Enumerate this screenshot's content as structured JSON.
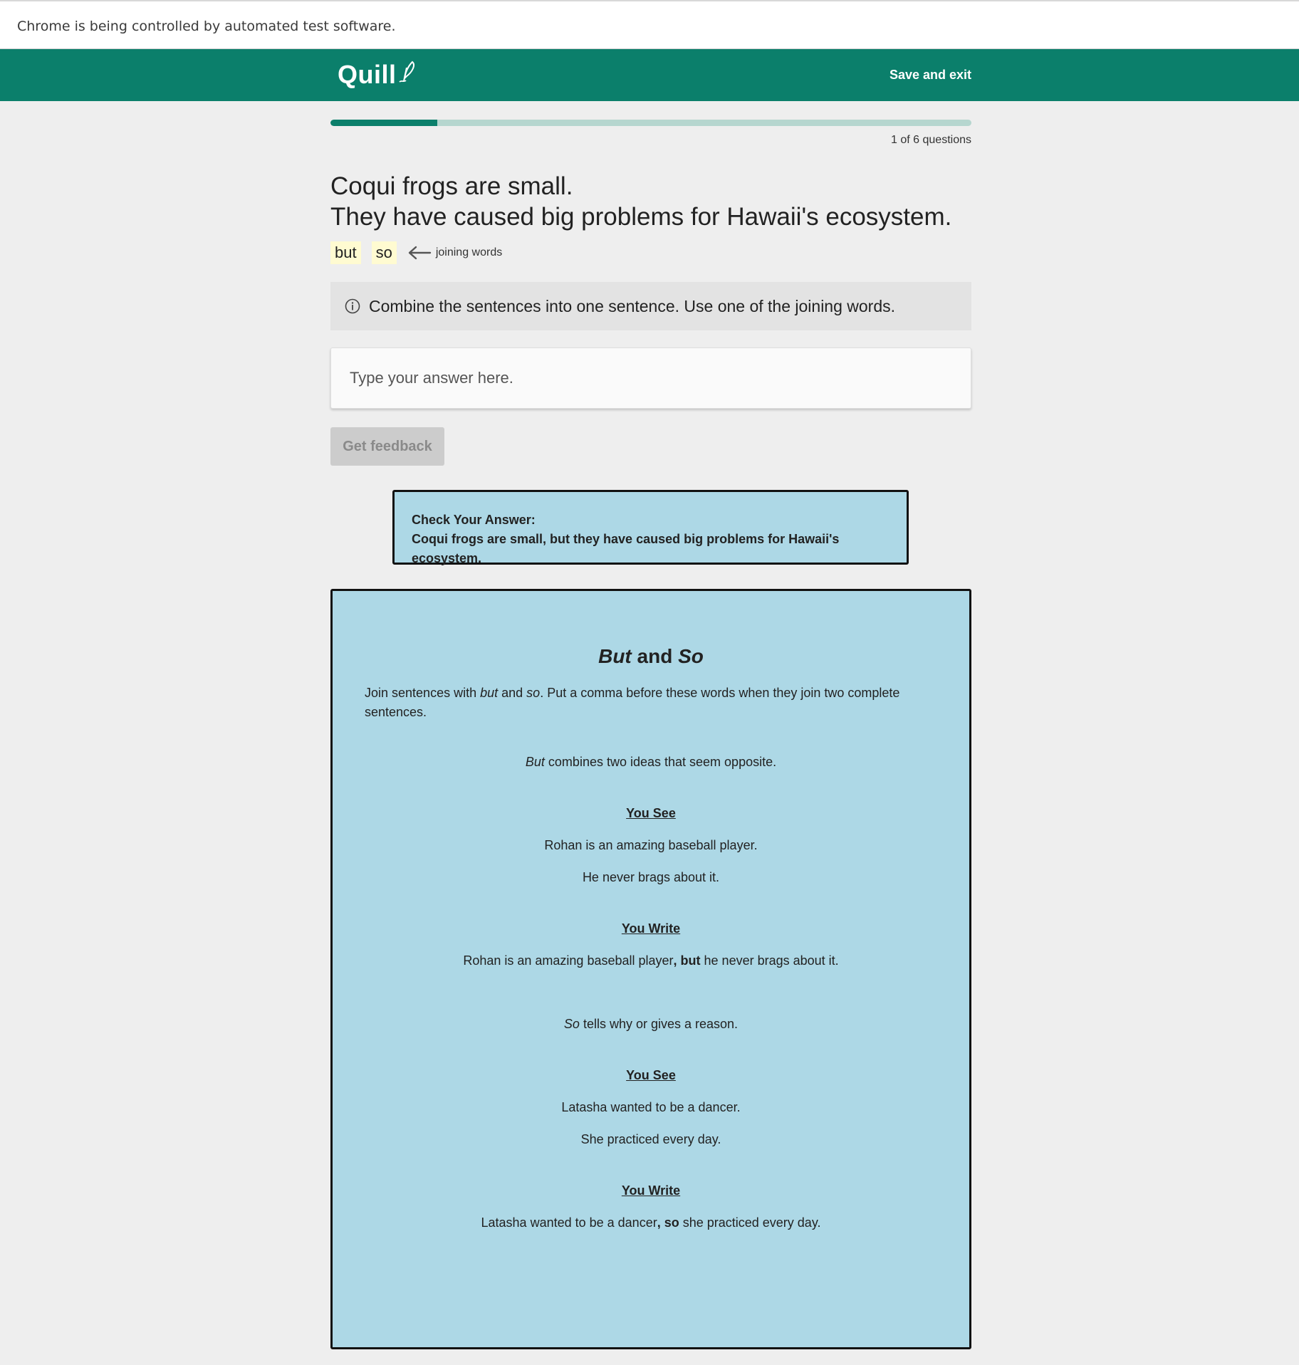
{
  "browser": {
    "automation_notice": "Chrome is being controlled by automated test software."
  },
  "header": {
    "logo_text": "Quill",
    "save_exit_label": "Save and exit",
    "brand_color": "#0b7f6b"
  },
  "progress": {
    "current": 1,
    "total": 6,
    "fraction": 0.1667,
    "label": "1 of 6 questions"
  },
  "prompt": {
    "sentence_1": "Coqui frogs are small.",
    "sentence_2": "They have caused big problems for Hawaii's ecosystem."
  },
  "joining_words": {
    "words": [
      "but",
      "so"
    ],
    "label": "joining words"
  },
  "instructions": {
    "icon": "info-icon",
    "text": "Combine the sentences into one sentence. Use one of the joining words."
  },
  "answer": {
    "placeholder": "Type your answer here.",
    "value": ""
  },
  "feedback_button": {
    "label": "Get feedback",
    "disabled": true
  },
  "check_answer": {
    "heading": "Check Your Answer:",
    "text": "Coqui frogs are small, but they have caused big problems for Hawaii's ecosystem."
  },
  "concept": {
    "title_part1": "But",
    "title_and": " and ",
    "title_part2": "So",
    "intro_1": "Join sentences with ",
    "intro_but": "but",
    "intro_2": " and ",
    "intro_so": "so",
    "intro_3": ". Put a comma before these words when they join two complete sentences.",
    "but_section": {
      "desc_word": "But",
      "desc_rest": " combines two ideas that seem opposite.",
      "you_see_label": "You See",
      "see_1": "Rohan is an amazing baseball player.",
      "see_2": "He never brags about it.",
      "you_write_label": "You Write",
      "write_pre": "Rohan is an amazing baseball player",
      "write_joiner": ", but",
      "write_post": " he never brags about it."
    },
    "so_section": {
      "desc_word": "So",
      "desc_rest": " tells why or gives a reason.",
      "you_see_label": "You See",
      "see_1": "Latasha wanted to be a dancer.",
      "see_2": "She practiced every day.",
      "you_write_label": "You Write",
      "write_pre": "Latasha wanted to be a dancer",
      "write_joiner": ", so",
      "write_post": " she practiced every day."
    },
    "box_color": "#add8e6"
  }
}
